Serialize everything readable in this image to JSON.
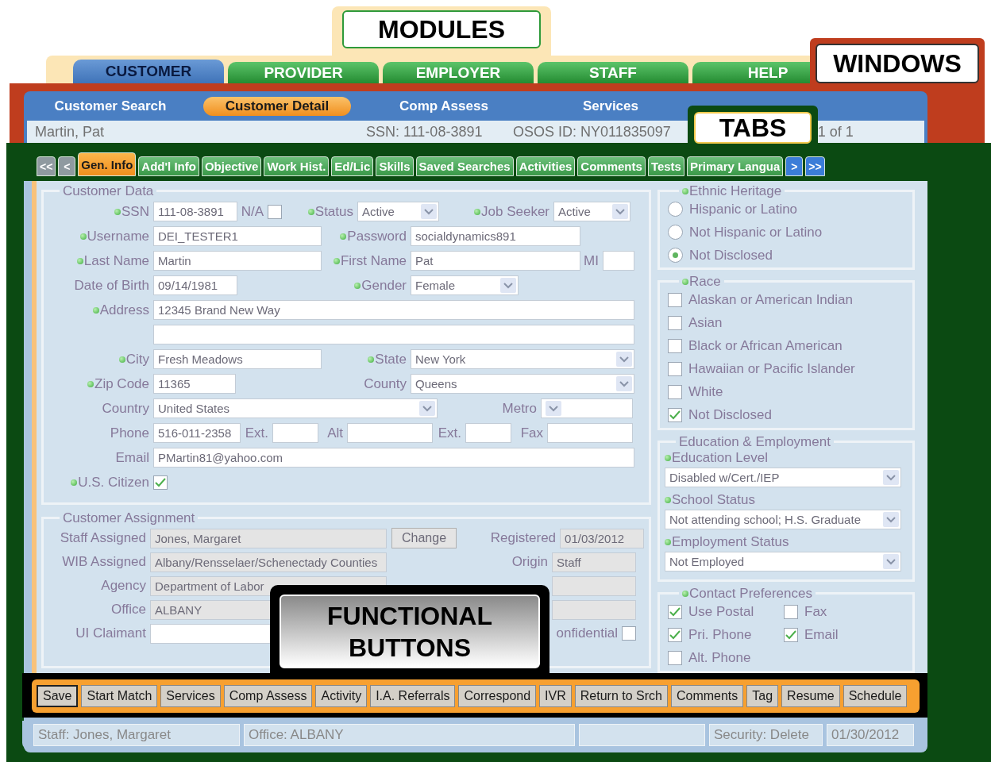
{
  "modules": {
    "callout": "MODULES",
    "tabs": [
      {
        "label": "CUSTOMER",
        "selected": true
      },
      {
        "label": "PROVIDER",
        "selected": false
      },
      {
        "label": "EMPLOYER",
        "selected": false
      },
      {
        "label": "STAFF",
        "selected": false
      },
      {
        "label": "HELP",
        "selected": false
      }
    ]
  },
  "windows": {
    "callout": "WINDOWS",
    "tabs": [
      {
        "label": "Customer Search",
        "selected": false
      },
      {
        "label": "Customer Detail",
        "selected": true
      },
      {
        "label": "Comp Assess",
        "selected": false
      },
      {
        "label": "Services",
        "selected": false
      }
    ],
    "record": {
      "name": "Martin, Pat",
      "ssn": "SSN: 111-08-3891",
      "osos_id": "OSOS ID: NY011835097",
      "position": "1 of 1"
    }
  },
  "tabs": {
    "callout": "TABS",
    "scroll_left": [
      {
        "label": "<<",
        "disabled": true
      },
      {
        "label": "<",
        "disabled": true
      }
    ],
    "items": [
      {
        "label": "Gen. Info",
        "selected": true
      },
      {
        "label": "Add'l Info",
        "selected": false
      },
      {
        "label": "Objective",
        "selected": false
      },
      {
        "label": "Work Hist.",
        "selected": false
      },
      {
        "label": "Ed/Lic",
        "selected": false
      },
      {
        "label": "Skills",
        "selected": false
      },
      {
        "label": "Saved Searches",
        "selected": false
      },
      {
        "label": "Activities",
        "selected": false
      },
      {
        "label": "Comments",
        "selected": false
      },
      {
        "label": "Tests",
        "selected": false
      },
      {
        "label": "Primary Langua",
        "selected": false
      }
    ],
    "scroll_right": [
      {
        "label": ">",
        "disabled": false
      },
      {
        "label": ">>",
        "disabled": false
      }
    ]
  },
  "customer_data": {
    "title": "Customer Data",
    "ssn": {
      "label": "SSN",
      "value": "111-08-3891",
      "required": true
    },
    "na": {
      "label": "N/A",
      "checked": false
    },
    "status": {
      "label": "Status",
      "value": "Active",
      "required": true
    },
    "job_seeker": {
      "label": "Job Seeker",
      "value": "Active",
      "required": true
    },
    "username": {
      "label": "Username",
      "value": "DEI_TESTER1",
      "required": true
    },
    "password": {
      "label": "Password",
      "value": "socialdynamics891",
      "required": true
    },
    "last_name": {
      "label": "Last Name",
      "value": "Martin",
      "required": true
    },
    "first_name": {
      "label": "First Name",
      "value": "Pat",
      "required": true
    },
    "mi": {
      "label": "MI",
      "required": false
    },
    "date_of_birth": {
      "label": "Date of Birth",
      "value": "09/14/1981",
      "required": false
    },
    "gender": {
      "label": "Gender",
      "value": "Female",
      "required": true
    },
    "address": {
      "label": "Address",
      "value": "12345 Brand New Way",
      "required": true
    },
    "city": {
      "label": "City",
      "value": "Fresh Meadows",
      "required": true
    },
    "state": {
      "label": "State",
      "value": "New York",
      "required": true
    },
    "zip_code": {
      "label": "Zip Code",
      "value": "11365",
      "required": true
    },
    "county": {
      "label": "County",
      "value": "Queens",
      "required": false
    },
    "country": {
      "label": "Country",
      "value": "United States",
      "required": false
    },
    "metro": {
      "label": "Metro",
      "required": false
    },
    "phone": {
      "label": "Phone",
      "value": "516-011-2358",
      "required": false
    },
    "phone_ext": {
      "label": "Ext.",
      "required": false
    },
    "alt": {
      "label": "Alt",
      "required": false
    },
    "alt_ext": {
      "label": "Ext.",
      "required": false
    },
    "fax": {
      "label": "Fax",
      "required": false
    },
    "email": {
      "label": "Email",
      "value": "PMartin81@yahoo.com",
      "required": false
    },
    "us_citizen": {
      "label": "U.S. Citizen",
      "checked": true,
      "required": true
    }
  },
  "customer_assignment": {
    "title": "Customer Assignment",
    "rows": [
      {
        "label": "Staff Assigned",
        "value": "Jones, Margaret",
        "disabled": true,
        "button": "Change",
        "right": {
          "kind": "field",
          "label": "Registered",
          "value": "01/03/2012",
          "disabled": true
        }
      },
      {
        "label": "WIB Assigned",
        "value": "Albany/Rensselaer/Schenectady Counties",
        "disabled": true,
        "right": {
          "kind": "field",
          "label": "Origin",
          "value": "Staff",
          "disabled": true
        }
      },
      {
        "label": "Agency",
        "value": "Department of Labor",
        "disabled": true,
        "right": {
          "kind": "field",
          "disabled": true
        }
      },
      {
        "label": "Office",
        "value": "ALBANY",
        "disabled": true,
        "right": {
          "kind": "field",
          "disabled": true
        }
      },
      {
        "label": "UI Claimant",
        "disabled": false,
        "right": {
          "kind": "checkbox",
          "label": "onfidential",
          "checked": false
        }
      }
    ]
  },
  "ethnic_heritage": {
    "title": "Ethnic Heritage",
    "required": true,
    "options": [
      {
        "label": "Hispanic or Latino",
        "selected": false
      },
      {
        "label": "Not Hispanic or Latino",
        "selected": false
      },
      {
        "label": "Not Disclosed",
        "selected": true
      }
    ]
  },
  "race": {
    "title": "Race",
    "required": true,
    "options": [
      {
        "label": "Alaskan or American Indian",
        "checked": false
      },
      {
        "label": "Asian",
        "checked": false
      },
      {
        "label": "Black or African American",
        "checked": false
      },
      {
        "label": "Hawaiian or Pacific Islander",
        "checked": false
      },
      {
        "label": "White",
        "checked": false
      },
      {
        "label": "Not Disclosed",
        "checked": true
      }
    ]
  },
  "education_employment": {
    "title": "Education & Employment",
    "fields": [
      {
        "label": "Education Level",
        "value": "Disabled w/Cert./IEP",
        "required": true
      },
      {
        "label": "School Status",
        "value": "Not attending school; H.S. Graduate",
        "required": true
      },
      {
        "label": "Employment Status",
        "value": "Not Employed",
        "required": true
      }
    ]
  },
  "contact_preferences": {
    "title": "Contact Preferences",
    "required": true,
    "options": [
      {
        "label": "Use Postal",
        "checked": true
      },
      {
        "label": "Fax",
        "checked": false
      },
      {
        "label": "Pri. Phone",
        "checked": true
      },
      {
        "label": "Email",
        "checked": true
      },
      {
        "label": "Alt. Phone",
        "checked": false
      }
    ]
  },
  "functional_buttons": {
    "callout": "FUNCTIONAL BUTTONS",
    "buttons": [
      {
        "label": "Save",
        "default": true
      },
      {
        "label": "Start Match",
        "default": false
      },
      {
        "label": "Services",
        "default": false
      },
      {
        "label": "Comp Assess",
        "default": false
      },
      {
        "label": "Activity",
        "default": false
      },
      {
        "label": "I.A. Referrals",
        "default": false
      },
      {
        "label": "Correspond",
        "default": false
      },
      {
        "label": "IVR",
        "default": false
      },
      {
        "label": "Return to Srch",
        "default": false
      },
      {
        "label": "Comments",
        "default": false
      },
      {
        "label": "Tag",
        "default": false
      },
      {
        "label": "Resume",
        "default": false
      },
      {
        "label": "Schedule",
        "default": false
      }
    ]
  },
  "status_bar": {
    "staff": "Staff: Jones, Margaret",
    "office": "Office: ALBANY",
    "security": "Security: Delete",
    "date": "01/30/2012"
  }
}
